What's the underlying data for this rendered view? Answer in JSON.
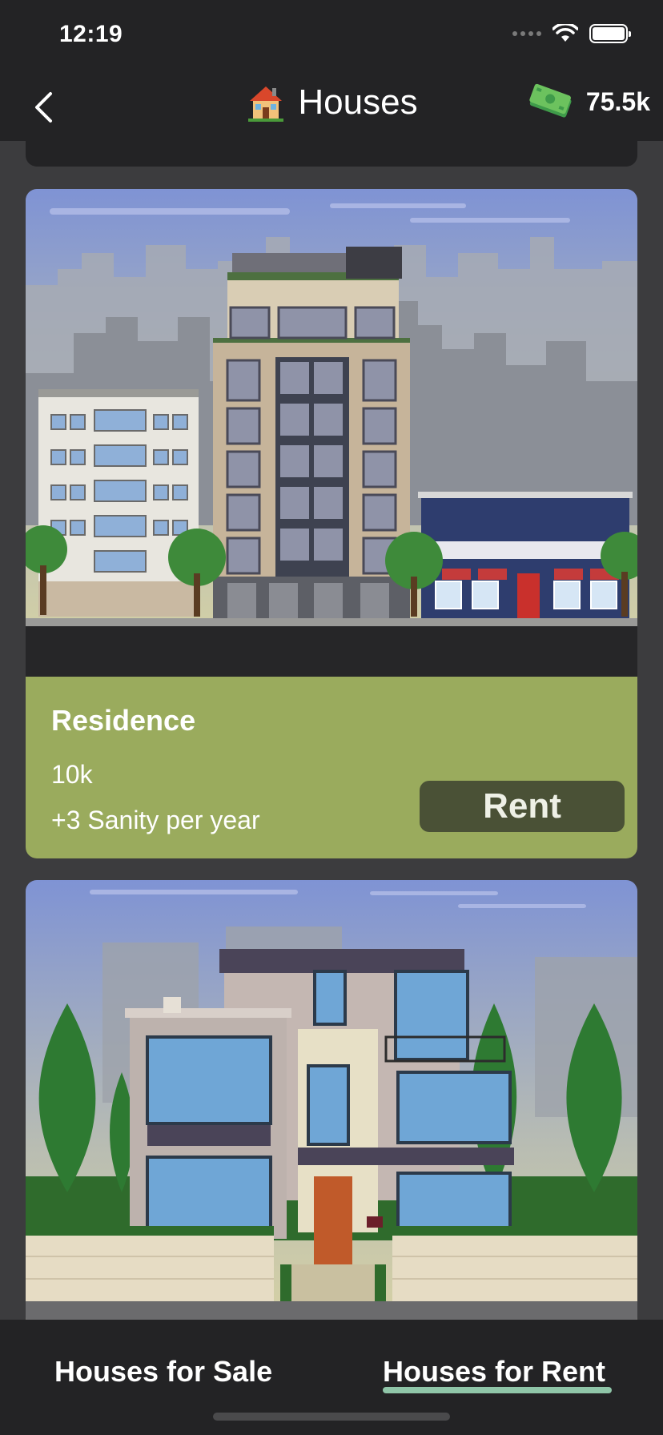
{
  "status": {
    "time": "12:19"
  },
  "header": {
    "title": "Houses",
    "title_icon": "house-emoji-icon",
    "money": "75.5k",
    "money_icon": "cash-stack-icon"
  },
  "cards": [
    {
      "name": "Residence",
      "price": "10k",
      "perk": "+3 Sanity per year",
      "action_label": "Rent"
    },
    {
      "image": "modern-house-illustration"
    }
  ],
  "tabs": {
    "sale_label": "Houses for Sale",
    "rent_label": "Houses for Rent",
    "active": "Houses for Rent"
  },
  "colors": {
    "header_bg": "#232325",
    "page_bg": "#3c3c3e",
    "card_info_bg": "#9aab5d",
    "rent_button_bg": "#4a5136",
    "tab_underline": "#8fc5a8"
  }
}
